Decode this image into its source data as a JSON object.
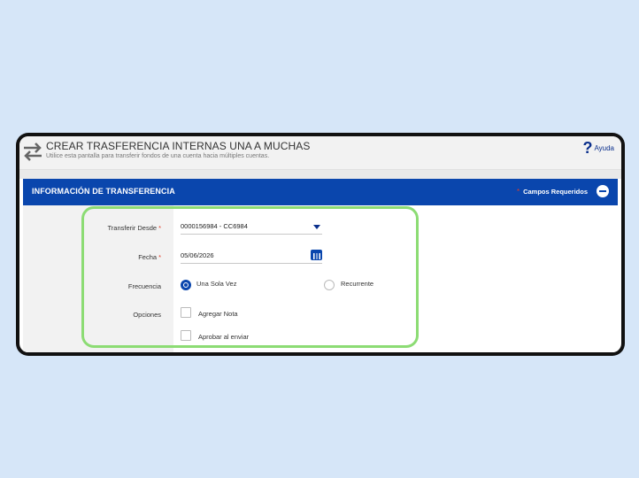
{
  "header": {
    "title": "CREAR TRASFERENCIA INTERNAS UNA A MUCHAS",
    "subtitle": "Utilice esta pantalla para transferir fondos de una cuenta hacia múltiples cuentas.",
    "help_label": "Ayuda",
    "help_icon": "?"
  },
  "section": {
    "title": "INFORMACIÓN DE TRANSFERENCIA",
    "required_star": "*",
    "required_label": "Campos Requeridos"
  },
  "form": {
    "from_label": "Transferir Desde",
    "from_value": "0000156984 - CC6984",
    "date_label": "Fecha",
    "date_value": "05/06/2026",
    "frequency_label": "Frecuencia",
    "frequency_options": [
      "Una Sola Vez",
      "Recurrente"
    ],
    "frequency_selected": "Una Sola Vez",
    "options_label": "Opciones",
    "option_items": [
      "Agregar Nota",
      "Aprobar al enviar"
    ],
    "required_star": "*"
  },
  "colors": {
    "brand_blue": "#0a46ad",
    "required_red": "#e23d28",
    "highlight_green": "#8cdc74",
    "background": "#d6e6f8"
  }
}
